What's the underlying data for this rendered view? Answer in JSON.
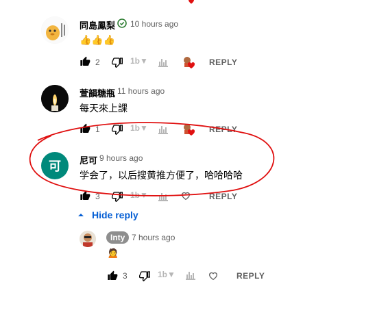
{
  "comments": [
    {
      "author": "同島鳳梨",
      "time": "10 hours ago",
      "text": "👍👍👍",
      "likes": "2",
      "reply_label": "REPLY",
      "verified_icon": "check-circle-icon",
      "colors": {
        "verified": "#2e7d32"
      }
    },
    {
      "author": "萱韻糖瓶",
      "time": "11 hours ago",
      "text": "每天來上課",
      "likes": "1",
      "reply_label": "REPLY"
    },
    {
      "author": "尼可",
      "time": "9 hours ago",
      "text": "学会了，以后搜黄推方便了，哈哈哈哈",
      "likes": "3",
      "reply_label": "REPLY",
      "avatar_letter": "可",
      "colors": {
        "avatar_bg": "#00897b"
      }
    }
  ],
  "hide_reply": {
    "label": "Hide reply",
    "color": "#065fd4"
  },
  "reply": {
    "author": "Inty",
    "time": "7 hours ago",
    "text": "🙍",
    "likes": "3",
    "reply_label": "REPLY"
  },
  "annotation": {
    "shape": "ellipse",
    "color": "#e01010"
  },
  "heart_color": "#e01010"
}
